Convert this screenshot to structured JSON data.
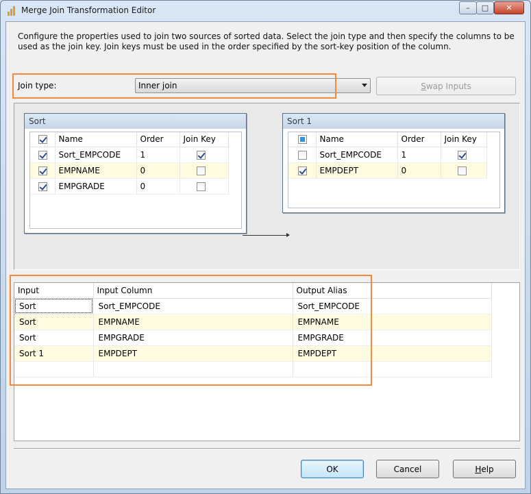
{
  "window": {
    "title": "Merge Join Transformation Editor",
    "controls": [
      "–",
      "□",
      "✕"
    ]
  },
  "description": "Configure the properties used to join two sources of sorted data. Select the join type and then specify the columns to be used as the join key. Join keys must be used in the order specified by the sort-key position of the column.",
  "join_type": {
    "label": "Join type:",
    "value": "Inner join"
  },
  "swap_inputs": {
    "prefix": "S",
    "rest": "wap Inputs"
  },
  "left_input": {
    "title": "Sort",
    "columns": [
      "Name",
      "Order",
      "Join Key"
    ],
    "rows": [
      {
        "name": "Sort_EMPCODE",
        "order": "1",
        "selected": true,
        "join_key": true
      },
      {
        "name": "EMPNAME",
        "order": "0",
        "selected": true,
        "join_key": false
      },
      {
        "name": "EMPGRADE",
        "order": "0",
        "selected": true,
        "join_key": false
      }
    ]
  },
  "right_input": {
    "title": "Sort 1",
    "columns": [
      "Name",
      "Order",
      "Join Key"
    ],
    "rows": [
      {
        "name": "Sort_EMPCODE",
        "order": "1",
        "selected": false,
        "join_key": true
      },
      {
        "name": "EMPDEPT",
        "order": "0",
        "selected": true,
        "join_key": false
      }
    ]
  },
  "output_grid": {
    "columns": [
      "Input",
      "Input Column",
      "Output Alias"
    ],
    "rows": [
      [
        "Sort",
        "Sort_EMPCODE",
        "Sort_EMPCODE"
      ],
      [
        "Sort",
        "EMPNAME",
        "EMPNAME"
      ],
      [
        "Sort",
        "EMPGRADE",
        "EMPGRADE"
      ],
      [
        "Sort 1",
        "EMPDEPT",
        "EMPDEPT"
      ],
      [
        "",
        "",
        ""
      ]
    ]
  },
  "buttons": {
    "ok": "OK",
    "cancel": "Cancel",
    "help_prefix": "H",
    "help_rest": "elp"
  },
  "colors": {
    "highlight": "#f58a3a",
    "alt_row": "#fefbe0"
  }
}
